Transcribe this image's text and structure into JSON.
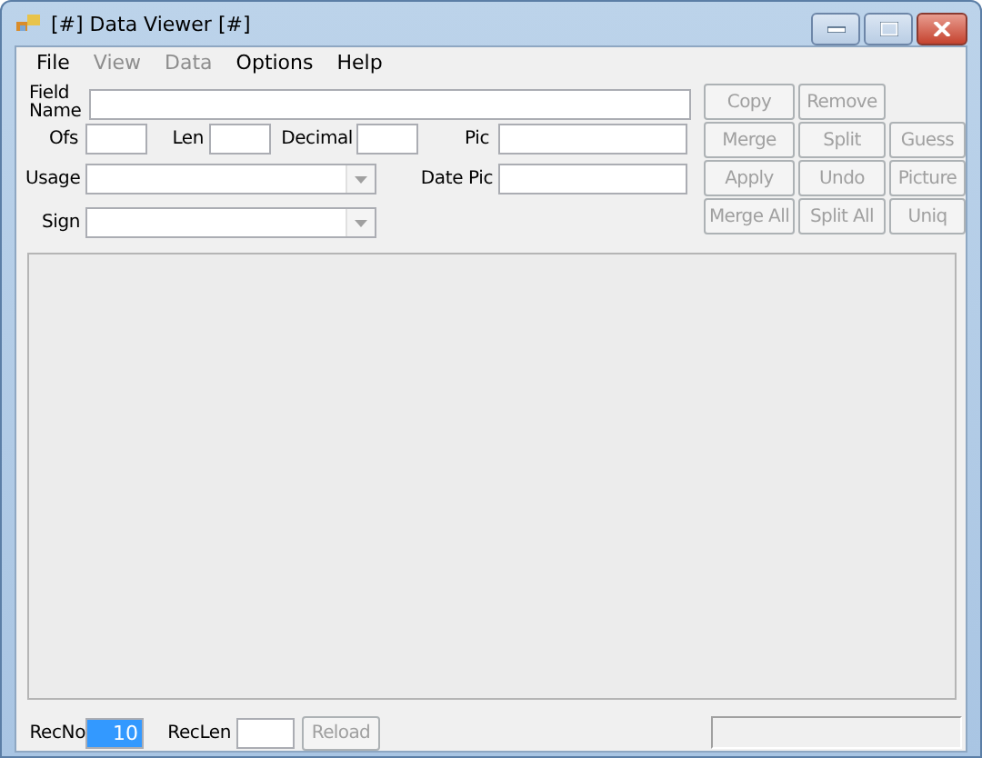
{
  "window": {
    "title": "[#] Data Viewer [#]"
  },
  "menu": [
    {
      "label": "File",
      "disabled": false
    },
    {
      "label": "View",
      "disabled": true
    },
    {
      "label": "Data",
      "disabled": true
    },
    {
      "label": "Options",
      "disabled": false
    },
    {
      "label": "Help",
      "disabled": false
    }
  ],
  "form": {
    "field_name_label": "Field Name",
    "ofs_label": "Ofs",
    "len_label": "Len",
    "decimal_label": "Decimal",
    "pic_label": "Pic",
    "usage_label": "Usage",
    "date_pic_label": "Date Pic",
    "sign_label": "Sign"
  },
  "button_rows": [
    [
      {
        "label": "Copy",
        "disabled": true
      },
      {
        "label": "Remove",
        "disabled": true
      }
    ],
    [
      {
        "label": "Merge",
        "disabled": true
      },
      {
        "label": "Split",
        "disabled": true
      },
      {
        "label": "Guess",
        "disabled": true
      }
    ],
    [
      {
        "label": "Apply",
        "disabled": true
      },
      {
        "label": "Undo",
        "disabled": true
      },
      {
        "label": "Picture",
        "disabled": true
      }
    ],
    [
      {
        "label": "Merge All",
        "disabled": true
      },
      {
        "label": "Split All",
        "disabled": true
      },
      {
        "label": "Uniq",
        "disabled": true
      }
    ]
  ],
  "bottom": {
    "recno_label": "RecNo",
    "recno_value": "10",
    "recno_selected": true,
    "reclen_label": "RecLen",
    "reload": {
      "label": "Reload",
      "disabled": true
    }
  }
}
